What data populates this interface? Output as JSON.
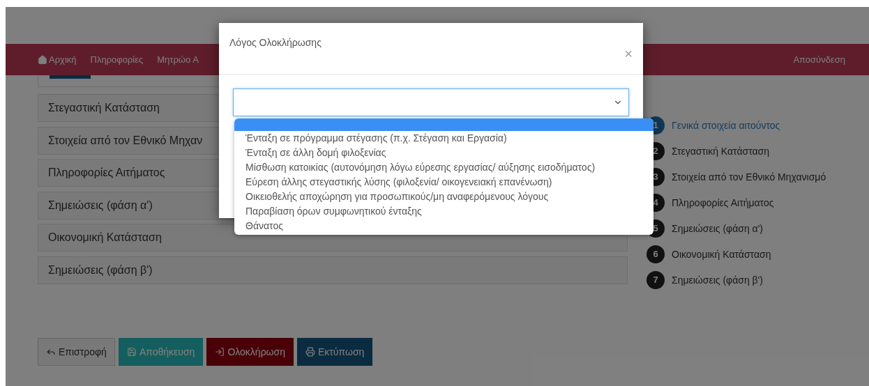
{
  "nav": {
    "items": [
      {
        "label": "Αρχική",
        "kind": "home"
      },
      {
        "label": "Πληροφορίες",
        "kind": "text"
      },
      {
        "label": "Μητρώο Α",
        "kind": "text"
      }
    ],
    "logout": "Αποσύνδεση"
  },
  "sections": [
    "Στεγαστική Κατάσταση",
    "Στοιχεία από τον Εθνικό Μηχαν",
    "Πληροφορίες Αιτήματος",
    "Σημειώσεις (φάση α')",
    "Οικονομική Κατάσταση",
    "Σημειώσεις (φάση β')"
  ],
  "steps": [
    {
      "number": "1",
      "label": "Γενικά στοιχεία αιτούντος",
      "selected": true
    },
    {
      "number": "2",
      "label": "Στεγαστική Κατάσταση",
      "selected": false
    },
    {
      "number": "3",
      "label": "Στοιχεία από τον Εθνικό Μηχανισμό",
      "selected": false
    },
    {
      "number": "4",
      "label": "Πληροφορίες Αιτήματος",
      "selected": false
    },
    {
      "number": "5",
      "label": "Σημειώσεις (φάση α')",
      "selected": false
    },
    {
      "number": "6",
      "label": "Οικονομική Κατάσταση",
      "selected": false
    },
    {
      "number": "7",
      "label": "Σημειώσεις (φάση β')",
      "selected": false
    }
  ],
  "buttons": [
    {
      "label": "Επιστροφή",
      "kind": "back"
    },
    {
      "label": "Αποθήκευση",
      "kind": "save"
    },
    {
      "label": "Ολοκλήρωση",
      "kind": "complete"
    },
    {
      "label": "Εκτύπωση",
      "kind": "print"
    }
  ],
  "modal": {
    "title": "Λόγος Ολοκλήρωσης",
    "close": "×",
    "select": {
      "expanded": true,
      "blank_option_highlighted": true,
      "options": [
        "Ένταξη σε πρόγραμμα στέγασης (π.χ. Στέγαση και Εργασία)",
        "Ένταξη σε άλλη δομή φιλοξενίας",
        "Μίσθωση κατοικίας (αυτονόμηση λόγω εύρεσης εργασίας/ αύξησης εισοδήματος)",
        "Εύρεση άλλης στεγαστικής λύσης (φιλοξενία/ οικογενειακή επανένωση)",
        "Οικειοθελής αποχώρηση για προσωπικούς/μη αναφερόμενους λόγους",
        "Παραβίαση όρων συμφωνητικού ένταξης",
        "Θάνατος"
      ]
    }
  }
}
